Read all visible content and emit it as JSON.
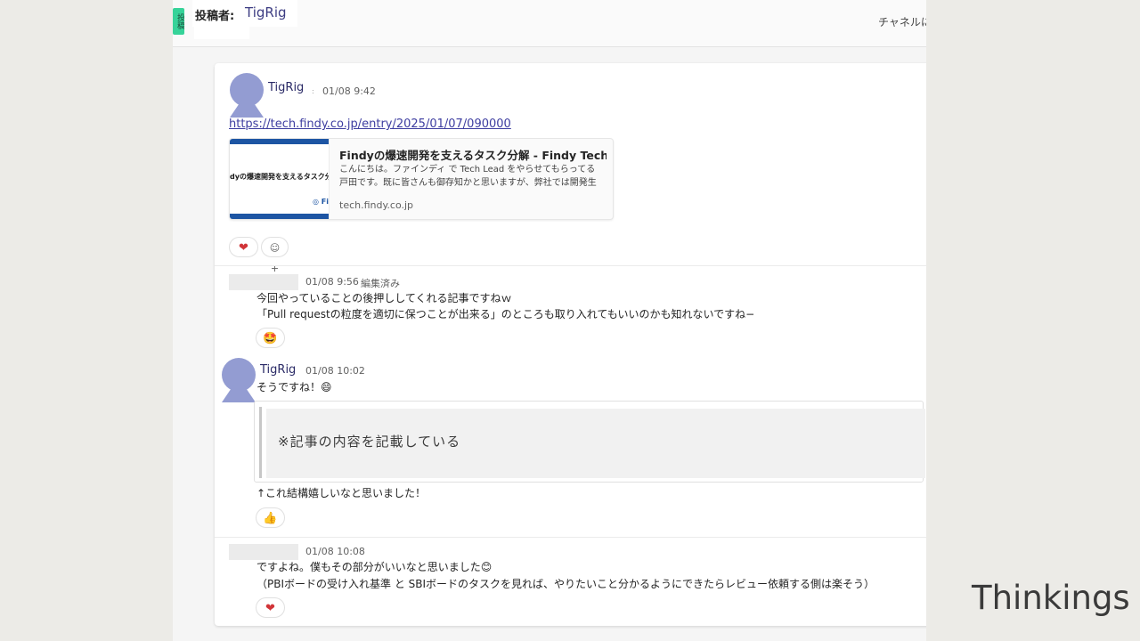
{
  "header": {
    "side_tab": "投稿",
    "poster_label": "投稿者:",
    "poster_name": "TigRig",
    "channel_link": "チャネルに移"
  },
  "post": {
    "author": "TigRig",
    "time": "01/08 9:42",
    "url": "https://tech.findy.co.jp/entry/2025/01/07/090000",
    "preview": {
      "thumb_text": "dyの爆速開発を支えるタスク分",
      "thumb_logo": "◎ Fi",
      "title": "Findyの爆速開発を支えるタスク分解 - Findy Tech B...",
      "description": "こんにちは。ファインディ で Tech Lead をやらせてもらってる戸田です。既に皆さんも御存知かと思いますが、弊社では開発生産性...",
      "domain": "tech.findy.co.jp"
    },
    "reactions": [
      "❤",
      "☺+"
    ]
  },
  "replies": [
    {
      "time": "01/08 9:56",
      "edited": "編集済み",
      "lines": [
        "今回やっていることの後押ししてくれる記事ですねｗ",
        "「Pull requestの粒度を適切に保つことが出来る」のところも取り入れてもいいのかも知れないですね−"
      ],
      "reaction": "🤩"
    },
    {
      "author": "TigRig",
      "time": "01/08 10:02",
      "line1": "そうですね！😄",
      "quote": "※記事の内容を記載している",
      "line2": "↑これ結構嬉しいなと思いました！",
      "reaction": "👍"
    },
    {
      "time": "01/08 10:08",
      "lines": [
        "ですよね。僕もその部分がいいなと思いました😊",
        "（PBIボードの受け入れ基準 と SBIボードのタスクを見れば、やりたいこと分かるようにできたらレビュー依頼する側は楽そう）"
      ],
      "reaction": "❤"
    }
  ],
  "brand": "Thinkings",
  "colors": {
    "avatar": "#939cd2",
    "link": "#3d3da0",
    "accent_green": "#36d399"
  }
}
